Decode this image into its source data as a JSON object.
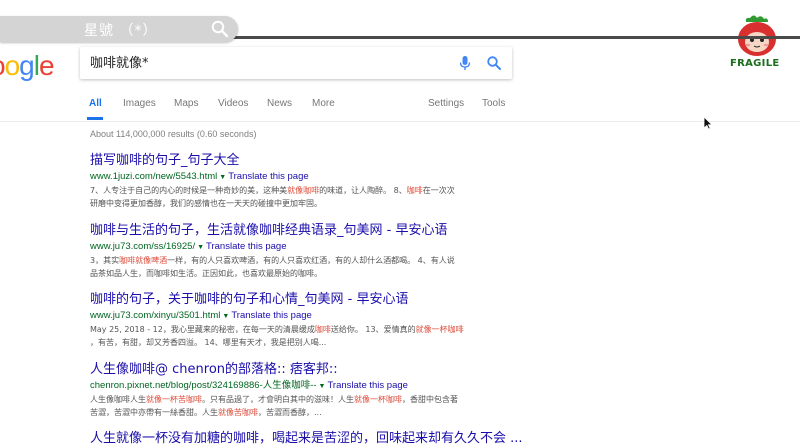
{
  "overlay": {
    "caption": "星號 （*）"
  },
  "logo": {
    "letters": [
      "o",
      "o",
      "g",
      "l",
      "e"
    ]
  },
  "search": {
    "value": "咖啡就像*"
  },
  "tabs": [
    {
      "label": "All"
    },
    {
      "label": "Images"
    },
    {
      "label": "Maps"
    },
    {
      "label": "Videos"
    },
    {
      "label": "News"
    },
    {
      "label": "More"
    },
    {
      "label": "Settings"
    },
    {
      "label": "Tools"
    }
  ],
  "stats": "About 114,000,000 results (0.60 seconds)",
  "translate_label": "Translate this page",
  "results": [
    {
      "title": "描写咖啡的句子_句子大全",
      "url": "www.1juzi.com/new/5543.html",
      "snippet_parts": [
        {
          "text": "7、人专注于自己的内心的时候是一种奇妙的美，这种美",
          "hl": false
        },
        {
          "text": "就像咖啡",
          "hl": true
        },
        {
          "text": "的味道，让人陶醉。 8、",
          "hl": false
        },
        {
          "text": "咖啡",
          "hl": true
        },
        {
          "text": "在一次次",
          "hl": false
        }
      ],
      "snippet_line2": "研磨中变得更加香醇，我们的感情也在一天天的碰撞中更加牢固。"
    },
    {
      "title": "咖啡与生活的句子，生活就像咖啡经典语录_句美网 - 早安心语",
      "url": "www.ju73.com/ss/16925/",
      "snippet_parts": [
        {
          "text": "3，其实",
          "hl": false
        },
        {
          "text": "咖啡就像啤酒",
          "hl": true
        },
        {
          "text": "一样，有的人只喜欢啤酒，有的人只喜欢红酒，有的人却什么酒都喝。 4、有人说",
          "hl": false
        }
      ],
      "snippet_line2": "品茶如品人生，而咖啡如生活。正因如此，也喜欢最原始的咖啡。"
    },
    {
      "title": "咖啡的句子，关于咖啡的句子和心情_句美网 - 早安心语",
      "url": "www.ju73.com/xinyu/3501.html",
      "snippet_parts": [
        {
          "text": "May 25, 2018 - 12，我心里藏来的秘密，在每一天的清晨缓成",
          "hl": false
        },
        {
          "text": "咖啡",
          "hl": true
        },
        {
          "text": "送给你。 13、爱情真的",
          "hl": false
        },
        {
          "text": "就像一杯咖啡",
          "hl": true
        }
      ],
      "snippet_line2": "，有苦，有甜，却又芳香四溢。 14、哪里有天才，我是把别人喝..."
    },
    {
      "title": "人生像咖啡@ chenron的部落格:: 痞客邦::",
      "url": "chenron.pixnet.net/blog/post/324169886-人生像咖啡--",
      "snippet_parts": [
        {
          "text": "人生像咖啡人生",
          "hl": false
        },
        {
          "text": "就像一杯苦咖啡",
          "hl": true
        },
        {
          "text": "。只有品過了，才會明白其中的滋味！人生",
          "hl": false
        },
        {
          "text": "就像一杯咖啡",
          "hl": true
        },
        {
          "text": "，香甜中包含著",
          "hl": false
        }
      ],
      "snippet_line2_parts": [
        {
          "text": "苦澀，苦澀中亦帶有一絲香甜。人生",
          "hl": false
        },
        {
          "text": "就像苦咖啡",
          "hl": true
        },
        {
          "text": "，苦澀而香醇，...",
          "hl": false
        }
      ]
    },
    {
      "title": "人生就像一杯没有加糖的咖啡，喝起来是苦涩的，回味起来却有久久不会 ..."
    }
  ],
  "mascot": {
    "label": "FRAGILE"
  },
  "colors": {
    "link": "#1a0dab",
    "url": "#006621",
    "highlight": "#dd4b39",
    "tab_active": "#1a73e8"
  }
}
